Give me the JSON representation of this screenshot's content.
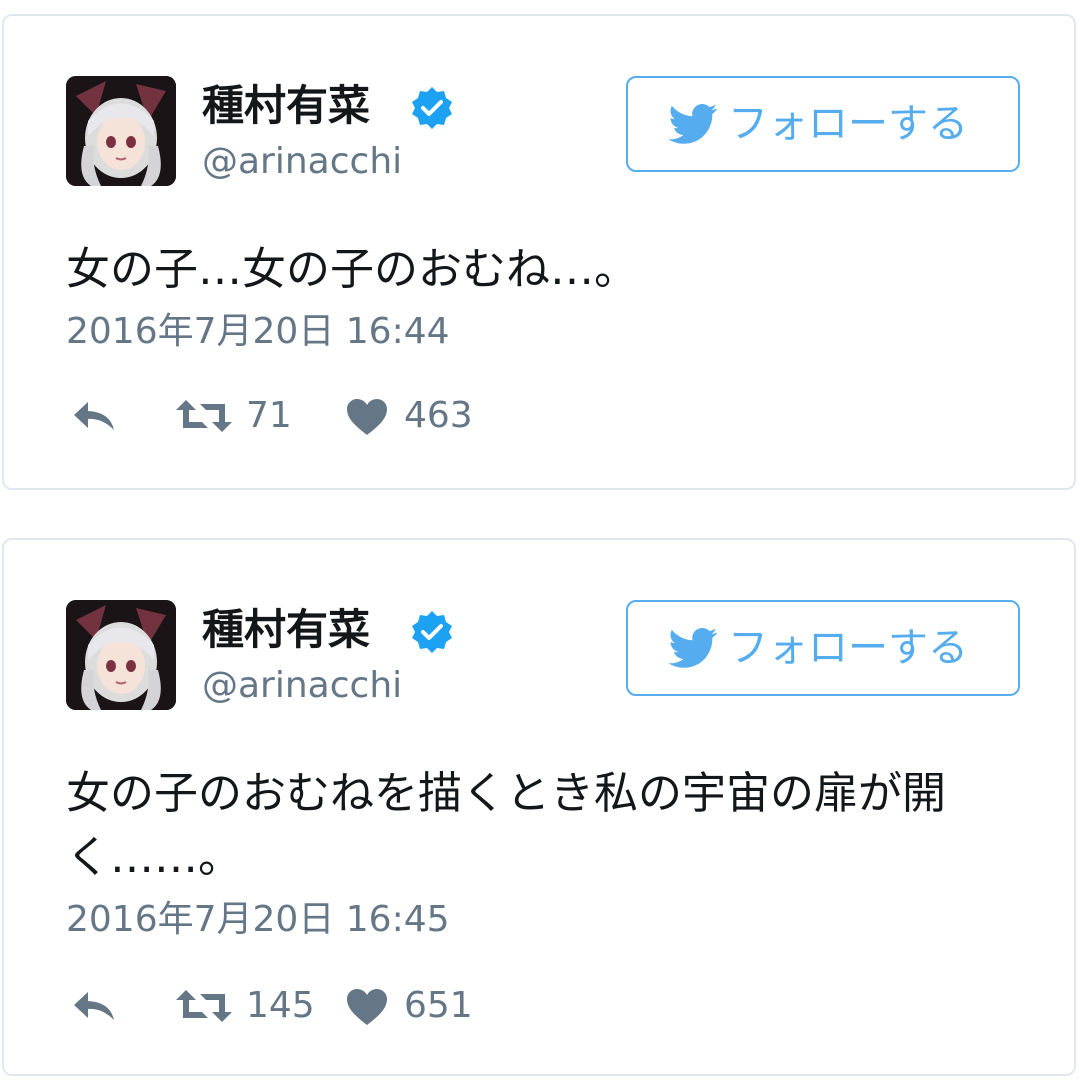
{
  "tweets": [
    {
      "author": {
        "name": "種村有菜",
        "handle": "@arinacchi",
        "verified": true,
        "avatar_icon": "anime-girl-avatar"
      },
      "follow_label": "フォローする",
      "text": "女の子…女の子のおむね…。",
      "timestamp": "2016年7月20日 16:44",
      "retweets": "71",
      "likes": "463"
    },
    {
      "author": {
        "name": "種村有菜",
        "handle": "@arinacchi",
        "verified": true,
        "avatar_icon": "anime-girl-avatar"
      },
      "follow_label": "フォローする",
      "text": "女の子のおむねを描くとき私の宇宙の扉が開く……。",
      "timestamp": "2016年7月20日 16:45",
      "retweets": "145",
      "likes": "651"
    }
  ],
  "colors": {
    "accent": "#55acee",
    "verified": "#1da1f2",
    "text": "#14171a",
    "muted": "#657786",
    "border": "#e1e8ed"
  }
}
